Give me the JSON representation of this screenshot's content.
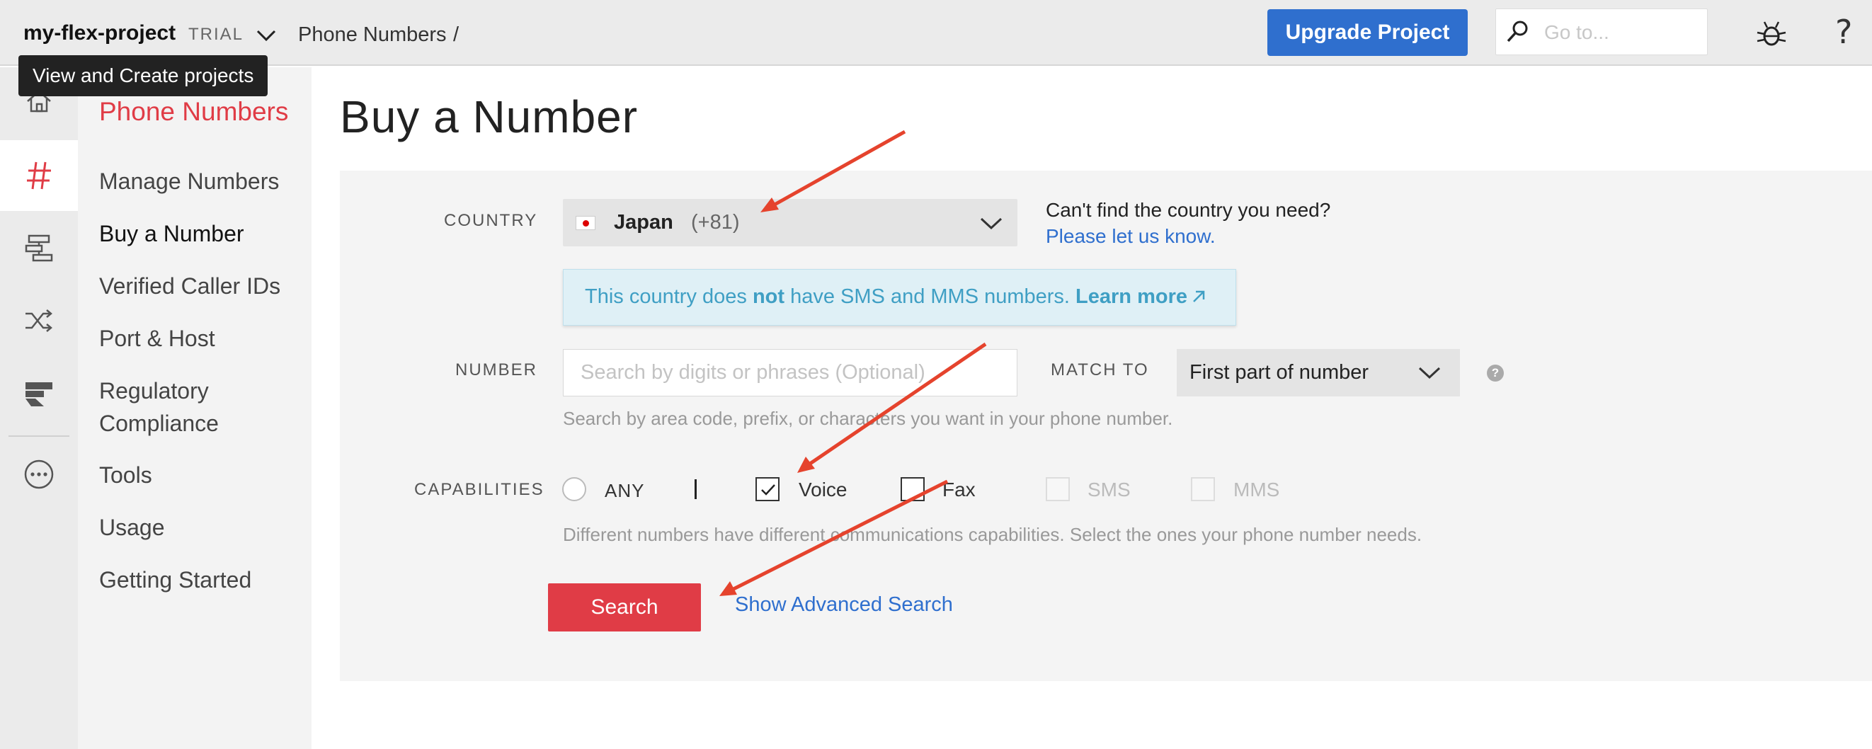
{
  "topbar": {
    "project_name": "my-flex-project",
    "plan_badge": "TRIAL",
    "breadcrumb": "Phone Numbers",
    "breadcrumb_separator": "/",
    "upgrade_label": "Upgrade Project",
    "goto_placeholder": "Go to...",
    "help_label": "?"
  },
  "tooltip": "View and Create projects",
  "rail": {
    "items": [
      "home-icon",
      "hash-icon",
      "flow-icon",
      "shuffle-icon",
      "flex-icon",
      "more-icon"
    ],
    "active": "hash-icon"
  },
  "sidebar": {
    "title": "Phone Numbers",
    "items": [
      {
        "label": "Manage Numbers"
      },
      {
        "label": "Buy a Number"
      },
      {
        "label": "Verified Caller IDs"
      },
      {
        "label": "Port & Host"
      },
      {
        "label": "Regulatory Compliance"
      },
      {
        "label": "Tools"
      },
      {
        "label": "Usage"
      },
      {
        "label": "Getting Started"
      }
    ],
    "active": "Buy a Number"
  },
  "main": {
    "title": "Buy a Number",
    "country": {
      "label": "COUNTRY",
      "name": "Japan",
      "code": "(+81)",
      "help_text": "Can't find the country you need?",
      "help_link": "Please let us know."
    },
    "notice": {
      "part1": "This country does ",
      "bold": "not",
      "part2": " have SMS and MMS numbers. ",
      "link": "Learn more"
    },
    "number": {
      "label": "NUMBER",
      "value": "",
      "placeholder": "Search by digits or phrases (Optional)",
      "match_label": "MATCH TO",
      "match_value": "First part of number",
      "help_badge": "?",
      "hint": "Search by area code, prefix, or characters you want in your phone number."
    },
    "capabilities": {
      "label": "CAPABILITIES",
      "any": "ANY",
      "voice": "Voice",
      "fax": "Fax",
      "sms": "SMS",
      "mms": "MMS",
      "voice_checked": true,
      "fax_checked": false,
      "hint": "Different numbers have different communications capabilities. Select the ones your phone number needs."
    },
    "search_label": "Search",
    "advanced_link": "Show Advanced Search"
  },
  "colors": {
    "accent_red": "#e03c46",
    "link_blue": "#2f6fce",
    "annotation_arrow": "#e5432d"
  }
}
